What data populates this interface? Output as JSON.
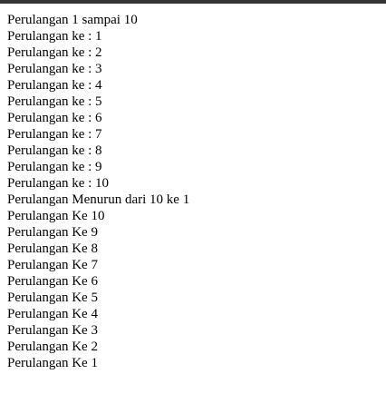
{
  "colors": {
    "background": "#ffffff",
    "text": "#000000",
    "top_bar": "#333333"
  },
  "output": {
    "lines": [
      "Perulangan 1 sampai 10",
      "Perulangan ke : 1",
      "Perulangan ke : 2",
      "Perulangan ke : 3",
      "Perulangan ke : 4",
      "Perulangan ke : 5",
      "Perulangan ke : 6",
      "Perulangan ke : 7",
      "Perulangan ke : 8",
      "Perulangan ke : 9",
      "Perulangan ke : 10",
      "Perulangan Menurun dari 10 ke 1",
      "Perulangan Ke 10",
      "Perulangan Ke 9",
      "Perulangan Ke 8",
      "Perulangan Ke 7",
      "Perulangan Ke 6",
      "Perulangan Ke 5",
      "Perulangan Ke 4",
      "Perulangan Ke 3",
      "Perulangan Ke 2",
      "Perulangan Ke 1"
    ]
  }
}
